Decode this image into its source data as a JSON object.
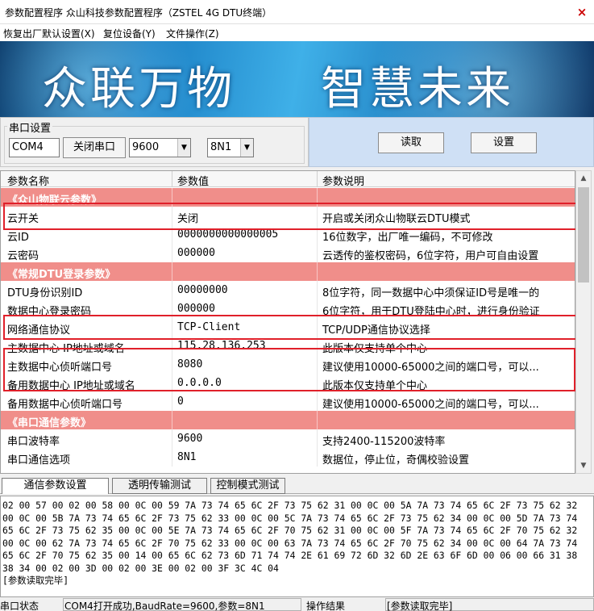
{
  "window": {
    "title": "参数配置程序  众山科技参数配置程序（ZSTEL 4G DTU终端）",
    "close": "×"
  },
  "menu": [
    "恢复出厂默认设置(X)",
    "复位设备(Y)",
    "文件操作(Z)"
  ],
  "banner": {
    "left": "众联万物",
    "right": "智慧未来"
  },
  "serial": {
    "group_label": "串口设置",
    "port": "COM4",
    "close_button": "关闭串口",
    "baud": "9600",
    "format": "8N1"
  },
  "actions": {
    "read": "读取",
    "set": "设置"
  },
  "table": {
    "headers": [
      "参数名称",
      "参数值",
      "参数说明"
    ],
    "rows": [
      {
        "section": true,
        "name": "《众山物联云参数》",
        "value": "",
        "desc": ""
      },
      {
        "name": "云开关",
        "value": "关闭",
        "desc": "开启或关闭众山物联云DTU模式"
      },
      {
        "name": "云ID",
        "value": "0000000000000005",
        "desc": "16位数字，出厂唯一编码，不可修改"
      },
      {
        "name": "云密码",
        "value": "000000",
        "desc": "云透传的鉴权密码，6位字符，用户可自由设置"
      },
      {
        "section": true,
        "name": "《常规DTU登录参数》",
        "value": "",
        "desc": ""
      },
      {
        "name": "DTU身份识别ID",
        "value": "00000000",
        "desc": "8位字符，同一数据中心中须保证ID号是唯一的"
      },
      {
        "name": "数据中心登录密码",
        "value": "000000",
        "desc": "6位字符，用于DTU登陆中心时，进行身份验证"
      },
      {
        "name": "网络通信协议",
        "value": "TCP-Client",
        "desc": "TCP/UDP通信协议选择"
      },
      {
        "name": "主数据中心 IP地址或域名",
        "value": "115.28.136.253",
        "desc": "此版本仅支持单个中心"
      },
      {
        "name": "主数据中心侦听端口号",
        "value": "8080",
        "desc": "建议使用10000-65000之间的端口号，可以..."
      },
      {
        "name": "备用数据中心 IP地址或域名",
        "value": "0.0.0.0",
        "desc": "此版本仅支持单个中心"
      },
      {
        "name": "备用数据中心侦听端口号",
        "value": "0",
        "desc": "建议使用10000-65000之间的端口号，可以..."
      },
      {
        "section": true,
        "name": "《串口通信参数》",
        "value": "",
        "desc": ""
      },
      {
        "name": "串口波特率",
        "value": "9600",
        "desc": "支持2400-115200波特率"
      },
      {
        "name": "串口通信选项",
        "value": "8N1",
        "desc": "数据位，停止位，奇偶校验设置"
      }
    ]
  },
  "tabs": [
    "通信参数设置",
    "透明传输测试",
    "控制模式测试"
  ],
  "log": {
    "lines": [
      "02 00 57 00 02 00 58 00 0C 00 59 7A 73 74 65 6C 2F 73 75 62 31 00 0C 00 5A 7A 73 74 65 6C 2F 73 75 62 32",
      "00 0C 00 5B 7A 73 74 65 6C 2F 73 75 62 33 00 0C 00 5C 7A 73 74 65 6C 2F 73 75 62 34 00 0C 00 5D 7A 73 74",
      "65 6C 2F 73 75 62 35 00 0C 00 5E 7A 73 74 65 6C 2F 70 75 62 31 00 0C 00 5F 7A 73 74 65 6C 2F 70 75 62 32",
      "00 0C 00 62 7A 73 74 65 6C 2F 70 75 62 33 00 0C 00 63 7A 73 74 65 6C 2F 70 75 62 34 00 0C 00 64 7A 73 74",
      "65 6C 2F 70 75 62 35 00 14 00 65 6C 62 73 6D 71 74 74 2E 61 69 72 6D 32 6D 2E 63 6F 6D 00 06 00 66 31 38",
      "38 34 00 02 00 3D 00 02 00 3E 00 02 00 3F 3C 4C 04",
      "[参数读取完毕]"
    ]
  },
  "statusbar": {
    "label": "串口状态",
    "value": "COM4打开成功,BaudRate=9600,参数=8N1",
    "result_label": "操作结果",
    "result_value": "[参数读取完毕]"
  }
}
